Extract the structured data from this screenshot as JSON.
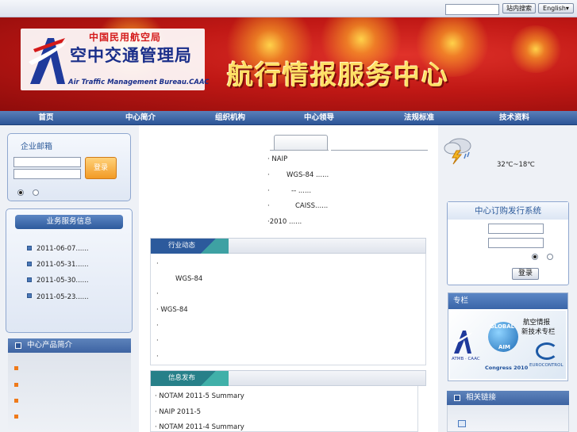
{
  "topbar": {
    "search_placeholder": "",
    "search_button": "站内搜索",
    "language_button": "English▾"
  },
  "banner": {
    "logo_cn_top": "中国民用航空局",
    "logo_cn_main": "空中交通管理局",
    "logo_en": "Air Traffic Management Bureau.CAAC",
    "title": "航行情报服务中心"
  },
  "nav": {
    "items": [
      "首页",
      "中心简介",
      "组织机构",
      "中心领导",
      "法规标准",
      "技术资料"
    ]
  },
  "mail_panel": {
    "title": "企业邮箱",
    "login_label": "登录"
  },
  "business_panel": {
    "title": "业务服务信息",
    "items": [
      "2011-06-07......",
      "2011-05-31......",
      "2011-05-30......",
      "2011-05-23......"
    ]
  },
  "products_panel": {
    "title": "中心产品简介"
  },
  "notices": {
    "items": [
      "·  NAIP",
      "WGS-84     ......",
      "--   ......",
      "CAISS......",
      "·2010              ......"
    ]
  },
  "industry": {
    "title": "行业动态",
    "items": [
      "·",
      "WGS-84",
      "·",
      "·   WGS-84",
      "·",
      "·",
      "·"
    ]
  },
  "release": {
    "title": "信息发布",
    "items": [
      "· NOTAM 2011-5 Summary",
      "· NAIP 2011-5",
      "· NOTAM 2011-4 Summary"
    ]
  },
  "weather": {
    "temperature": "32℃~18℃"
  },
  "subscription": {
    "title": "中心订购发行系统",
    "login_label": "登录"
  },
  "column": {
    "title": "专栏",
    "ad_line1": "航空情报",
    "ad_line2": "新技术专栏",
    "ad_global": "GLOBAL",
    "ad_aim": "AIM",
    "ad_congress": "Congress 2010",
    "ad_eurocontrol": "EUROCONTROL",
    "ad_atmb": "ATMB · CAAC"
  },
  "links": {
    "title": "相关链接"
  }
}
